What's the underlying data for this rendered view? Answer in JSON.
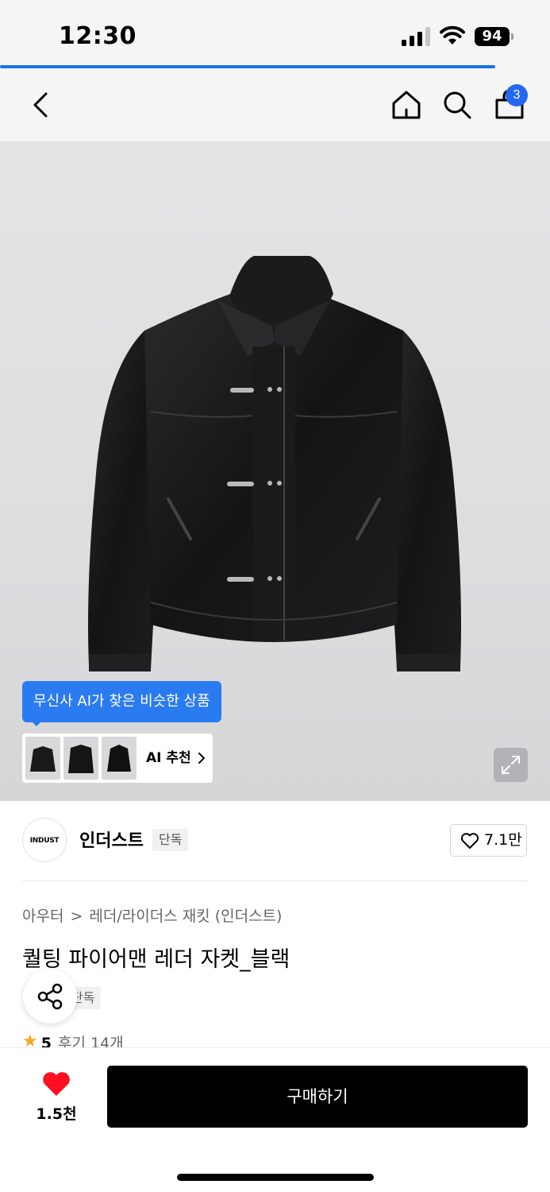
{
  "status_bar": {
    "time": "12:30",
    "battery": "94"
  },
  "page_load_progress": 0.9,
  "nav": {
    "cart_count": "3"
  },
  "ai": {
    "tooltip": "무신사 AI가 찾은 비슷한 상품",
    "label": "AI 추천"
  },
  "brand": {
    "logo_text": "INDUST",
    "name": "인더스트",
    "badge": "단독",
    "likes": "7.1만"
  },
  "breadcrumb": {
    "level1": "아우터",
    "separator": ">",
    "level2": "레더/라이더스 재킷 (인더스트)"
  },
  "product": {
    "title": "퀄팅 파이어맨 레더 자켓_블랙",
    "tag": "단독",
    "rating_star": "★",
    "rating": "5",
    "reviews": "후기 14개"
  },
  "bottom": {
    "wish_count": "1.5천",
    "buy_label": "구매하기"
  },
  "colors": {
    "accent_blue": "#2b7bf0",
    "badge_blue": "#2468f2",
    "wish_red": "#ff0f1f",
    "star": "#f5a623"
  }
}
